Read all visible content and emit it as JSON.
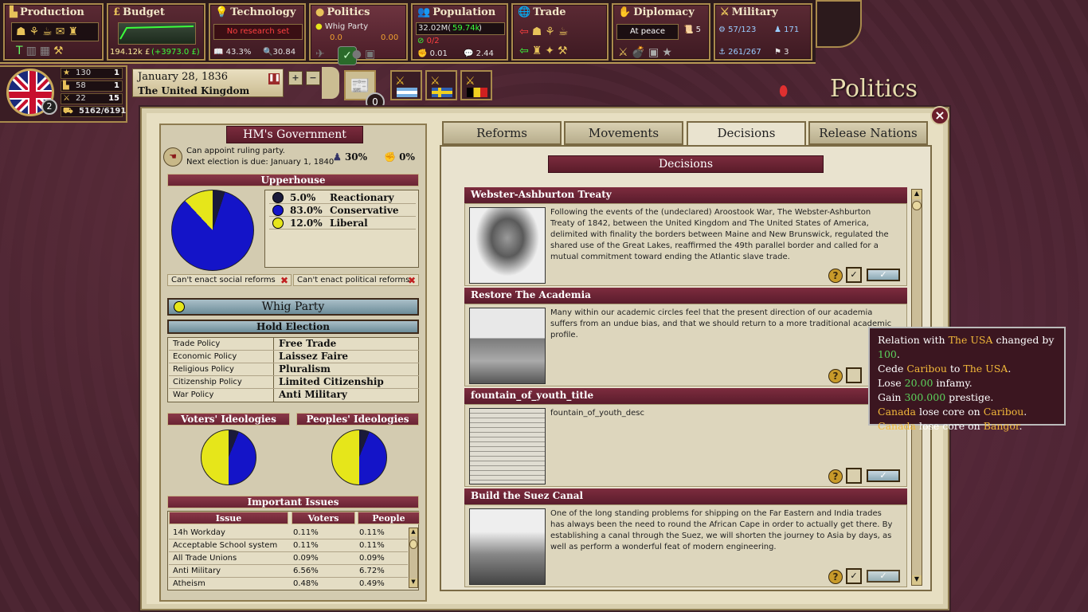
{
  "topbar": {
    "production": {
      "label": "Production"
    },
    "budget": {
      "label": "Budget",
      "funds": "194.12k £",
      "change": "(+3973.0 £)"
    },
    "technology": {
      "label": "Technology",
      "research": "No research set",
      "literacy": "43.3%",
      "research_points": "30.84"
    },
    "politics": {
      "label": "Politics",
      "party": "Whig Party",
      "val1": "0.0",
      "val2": "0.00"
    },
    "population": {
      "label": "Population",
      "total": "32.02M(",
      "growth": "59.74k",
      "close": ")",
      "crime": "0/2",
      "militancy": "0.01",
      "consciousness": "2.44"
    },
    "trade": {
      "label": "Trade"
    },
    "diplomacy": {
      "label": "Diplomacy",
      "status": "At peace",
      "count": "5"
    },
    "military": {
      "label": "Military",
      "army": "57/123",
      "mobilize": "171",
      "navy": "261/267",
      "admirals": "3"
    }
  },
  "country": {
    "badge": "2",
    "stats": [
      {
        "icon": "prestige",
        "value": "130",
        "rank": "1"
      },
      {
        "icon": "industry",
        "value": "58",
        "rank": "1"
      },
      {
        "icon": "military",
        "value": "22",
        "rank": "15"
      },
      {
        "icon": "supply",
        "value": "5162/6191",
        "rank": ""
      }
    ],
    "date": "January 28, 1836",
    "name": "The United Kingdom",
    "messages": "0"
  },
  "screen_title": "Politics",
  "government": {
    "title": "HM's Government",
    "line1": "Can appoint ruling party.",
    "line2": "Next election is due: January 1, 1840",
    "pct1": "30%",
    "pct2": "0%",
    "upperhouse": "Upperhouse",
    "legend": [
      {
        "pct": "5.0%",
        "name": "Reactionary",
        "color": "#1a1a3a"
      },
      {
        "pct": "83.0%",
        "name": "Conservative",
        "color": "#1414c8"
      },
      {
        "pct": "12.0%",
        "name": "Liberal",
        "color": "#e6e61a"
      }
    ],
    "social": "Can't enact social reforms",
    "political": "Can't enact political reforms",
    "party_button": "Whig Party",
    "election_button": "Hold Election",
    "policies": [
      {
        "name": "Trade Policy",
        "value": "Free Trade"
      },
      {
        "name": "Economic Policy",
        "value": "Laissez Faire"
      },
      {
        "name": "Religious Policy",
        "value": "Pluralism"
      },
      {
        "name": "Citizenship Policy",
        "value": "Limited Citizenship"
      },
      {
        "name": "War Policy",
        "value": "Anti Military"
      }
    ],
    "voters": "Voters' Ideologies",
    "peoples": "Peoples' Ideologies",
    "issues_title": "Important Issues",
    "issue_headers": [
      "Issue",
      "Voters",
      "People"
    ],
    "issues": [
      {
        "issue": "14h Workday",
        "voters": "0.11%",
        "people": "0.11%"
      },
      {
        "issue": "Acceptable School system",
        "voters": "0.11%",
        "people": "0.11%"
      },
      {
        "issue": "All Trade Unions",
        "voters": "0.09%",
        "people": "0.09%"
      },
      {
        "issue": "Anti Military",
        "voters": "6.56%",
        "people": "6.72%"
      },
      {
        "issue": "Atheism",
        "voters": "0.48%",
        "people": "0.49%"
      }
    ]
  },
  "tabs": [
    "Reforms",
    "Movements",
    "Decisions",
    "Release Nations"
  ],
  "decisions_title": "Decisions",
  "decisions": [
    {
      "title": "Webster-Ashburton Treaty",
      "text": "Following the events of the (undeclared) Aroostook War, The Webster-Ashburton Treaty of 1842, between the United Kingdom and The United States of America, delimited with finality the borders between Maine and New Brunswick, regulated the shared use of the Great Lakes, reaffirmed the 49th parallel border and called for a mutual commitment toward ending the Atlantic slave trade."
    },
    {
      "title": "Restore The Academia",
      "text": "Many within our academic circles feel that the present direction of our academia suffers from an undue bias, and that we should return to a more traditional academic profile."
    },
    {
      "title": "fountain_of_youth_title",
      "text": "fountain_of_youth_desc"
    },
    {
      "title": "Build the Suez Canal",
      "text": "One of the long standing problems for shipping on the Far Eastern and India trades has always been the need to round the African Cape in order to actually get there. By establishing a canal through the Suez, we will shorten the journey to Asia by days, as well as perform a wonderful feat of modern engineering."
    }
  ],
  "tooltip": {
    "l1a": "Relation with ",
    "l1b": "The USA",
    "l1c": " changed by ",
    "l1d": "100",
    "l1e": ".",
    "l2a": "Cede ",
    "l2b": "Caribou",
    "l2c": " to ",
    "l2d": "The USA",
    "l2e": ".",
    "l3a": "Lose ",
    "l3b": "20.00",
    "l3c": " infamy.",
    "l4a": "Gain ",
    "l4b": "300.000",
    "l4c": " prestige.",
    "l5a": "Canada",
    "l5b": " lose core on ",
    "l5c": "Caribou",
    "l5d": ".",
    "l6a": "Canada",
    "l6b": " lose core on ",
    "l6c": "Bangor",
    "l6d": "."
  }
}
